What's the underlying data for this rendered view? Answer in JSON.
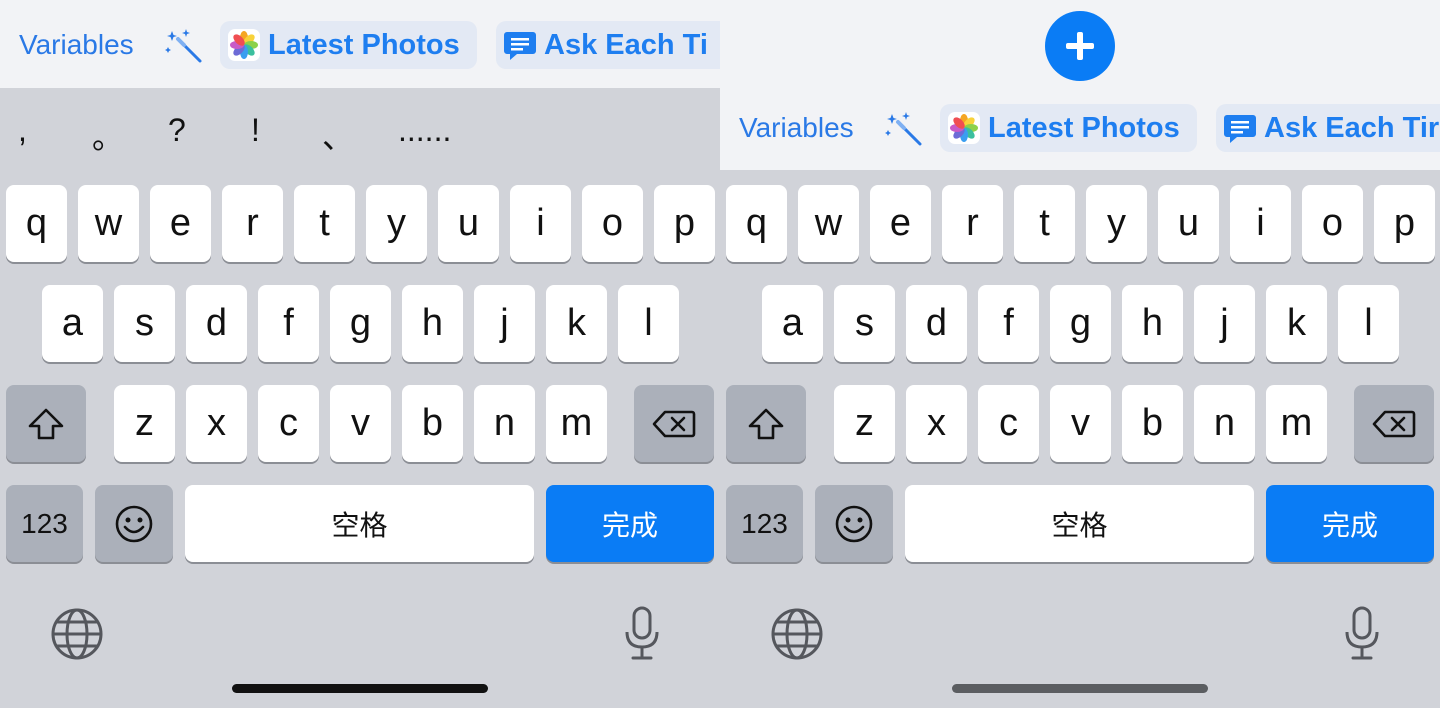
{
  "left": {
    "variables_label": "Variables",
    "latest_photos_label": "Latest Photos",
    "ask_each_time_label": "Ask Each Ti",
    "suggestions": [
      ",",
      "。",
      "?",
      "!",
      "、",
      "......"
    ],
    "row1": [
      "q",
      "w",
      "e",
      "r",
      "t",
      "y",
      "u",
      "i",
      "o",
      "p"
    ],
    "row2": [
      "a",
      "s",
      "d",
      "f",
      "g",
      "h",
      "j",
      "k",
      "l"
    ],
    "row3": [
      "z",
      "x",
      "c",
      "v",
      "b",
      "n",
      "m"
    ],
    "numbers_label": "123",
    "space_label": "空格",
    "done_label": "完成"
  },
  "right": {
    "variables_label": "Variables",
    "latest_photos_label": "Latest Photos",
    "ask_each_time_label": "Ask Each Tir",
    "row1": [
      "q",
      "w",
      "e",
      "r",
      "t",
      "y",
      "u",
      "i",
      "o",
      "p"
    ],
    "row2": [
      "a",
      "s",
      "d",
      "f",
      "g",
      "h",
      "j",
      "k",
      "l"
    ],
    "row3": [
      "z",
      "x",
      "c",
      "v",
      "b",
      "n",
      "m"
    ],
    "numbers_label": "123",
    "space_label": "空格",
    "done_label": "完成"
  },
  "colors": {
    "accent": "#0a7cf5",
    "keyboard_bg": "#d1d3d9",
    "toolbar_bg": "#f2f3f6",
    "special_key": "#abb0ba"
  },
  "icons": [
    "magic-wand-icon",
    "photos-icon",
    "message-icon",
    "shift-icon",
    "delete-icon",
    "emoji-icon",
    "globe-icon",
    "microphone-icon",
    "plus-icon"
  ]
}
